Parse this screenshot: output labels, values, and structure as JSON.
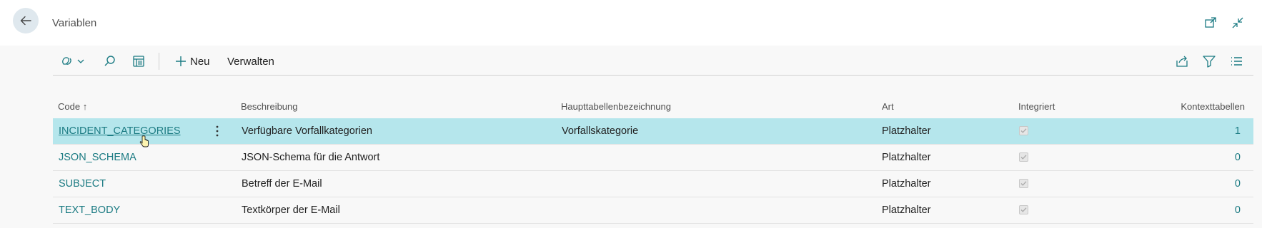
{
  "page": {
    "title": "Variablen"
  },
  "toolbar": {
    "new_label": "Neu",
    "manage_label": "Verwalten"
  },
  "table": {
    "headers": {
      "code": "Code",
      "sort_indicator": "↑",
      "description": "Beschreibung",
      "main_table": "Haupttabellenbezeichnung",
      "type": "Art",
      "integrated": "Integriert",
      "context_tables": "Kontexttabellen"
    },
    "rows": [
      {
        "code": "INCIDENT_CATEGORIES",
        "description": "Verfügbare Vorfallkategorien",
        "main_table": "Vorfallskategorie",
        "type": "Platzhalter",
        "integrated": true,
        "context_tables": "1",
        "selected": true
      },
      {
        "code": "JSON_SCHEMA",
        "description": "JSON-Schema für die Antwort",
        "main_table": "",
        "type": "Platzhalter",
        "integrated": true,
        "context_tables": "0",
        "selected": false
      },
      {
        "code": "SUBJECT",
        "description": "Betreff der E-Mail",
        "main_table": "",
        "type": "Platzhalter",
        "integrated": true,
        "context_tables": "0",
        "selected": false
      },
      {
        "code": "TEXT_BODY",
        "description": "Textkörper der E-Mail",
        "main_table": "",
        "type": "Platzhalter",
        "integrated": true,
        "context_tables": "0",
        "selected": false
      }
    ]
  },
  "icons": {
    "back": "arrow-left-icon",
    "popout": "open-in-new-window-icon",
    "collapse": "collapse-icon",
    "copilot": "copilot-icon",
    "search": "search-icon",
    "edit_list": "edit-list-icon",
    "add": "plus-icon",
    "share": "share-icon",
    "filter": "filter-icon",
    "list_view": "list-view-icon"
  },
  "colors": {
    "selected_row": "#b5e6ec",
    "link": "#1a7a82",
    "back_button": "#dfe8ee"
  }
}
